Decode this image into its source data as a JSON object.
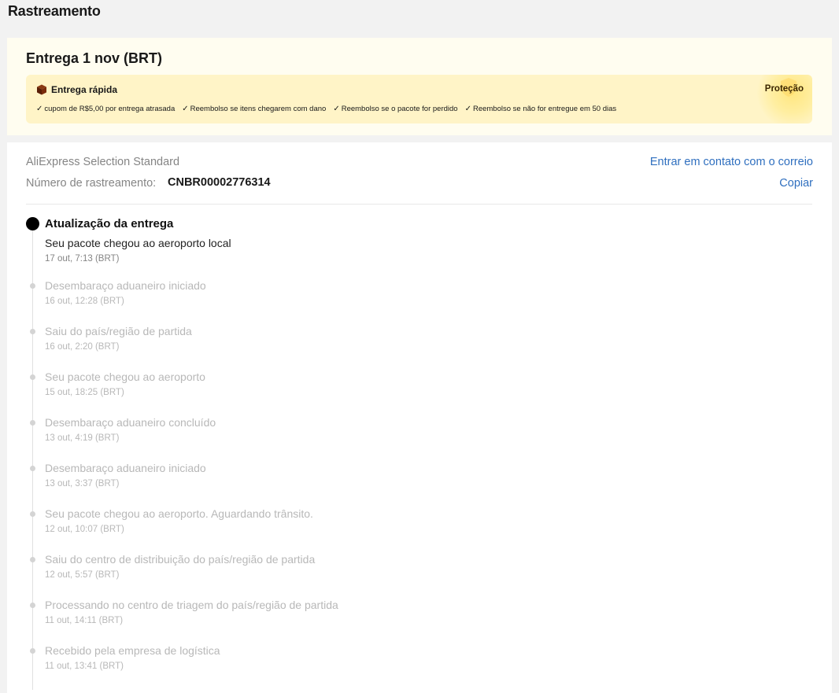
{
  "page": {
    "title": "Rastreamento"
  },
  "delivery": {
    "title": "Entrega 1 nov (BRT)",
    "badge": "Entrega rápida",
    "protection": "Proteção",
    "features": [
      "cupom de R$5,00 por entrega atrasada",
      "Reembolso se itens chegarem com dano",
      "Reembolso se o pacote for perdido",
      "Reembolso se não for entregue em 50 dias"
    ]
  },
  "tracking": {
    "carrier": "AliExpress Selection Standard",
    "number_label": "Número de rastreamento:",
    "number": "CNBR00002776314",
    "contact_link": "Entrar em contato com o correio",
    "copy_link": "Copiar"
  },
  "timeline": {
    "latest": {
      "heading": "Atualização da entrega",
      "title": "Seu pacote chegou ao aeroporto local",
      "time": "17 out, 7:13 (BRT)"
    },
    "events": [
      {
        "title": "Desembaraço aduaneiro iniciado",
        "time": "16 out, 12:28 (BRT)"
      },
      {
        "title": "Saiu do país/região de partida",
        "time": "16 out, 2:20 (BRT)"
      },
      {
        "title": "Seu pacote chegou ao aeroporto",
        "time": "15 out, 18:25 (BRT)"
      },
      {
        "title": "Desembaraço aduaneiro concluído",
        "time": "13 out, 4:19 (BRT)"
      },
      {
        "title": "Desembaraço aduaneiro iniciado",
        "time": "13 out, 3:37 (BRT)"
      },
      {
        "title": "Seu pacote chegou ao aeroporto. Aguardando trânsito.",
        "time": "12 out, 10:07 (BRT)"
      },
      {
        "title": "Saiu do centro de distribuição do país/região de partida",
        "time": "12 out, 5:57 (BRT)"
      },
      {
        "title": "Processando no centro de triagem do país/região de partida",
        "time": "11 out, 14:11 (BRT)"
      },
      {
        "title": "Recebido pela empresa de logística",
        "time": "11 out, 13:41 (BRT)"
      }
    ]
  },
  "colors": {
    "accent_link": "#2f6fbf",
    "promo_bg": "#fff4c7",
    "muted_text": "#b8b8b8"
  }
}
